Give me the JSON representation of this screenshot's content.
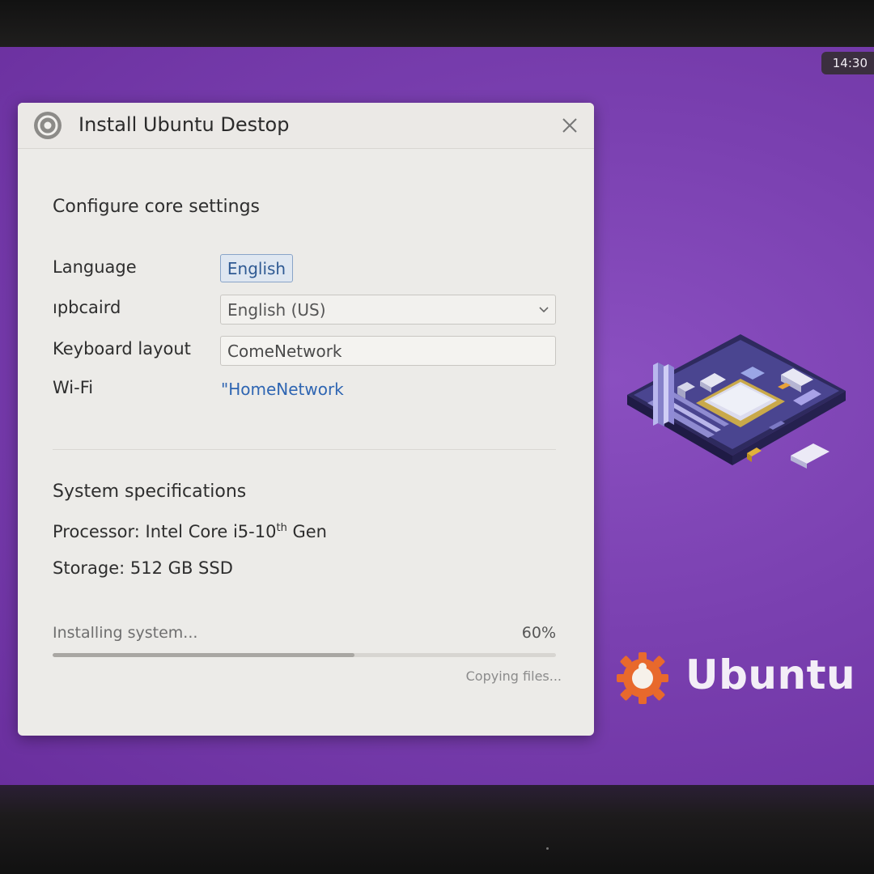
{
  "clock": "14:30",
  "window": {
    "title": "Install Ubuntu Destop"
  },
  "core_settings": {
    "heading": "Configure core settings",
    "language_label": "Language",
    "language_value": "English",
    "clipboard_label": "​ıpbcaird",
    "clipboard_value": "English (US)",
    "keyboard_label": "Keyboard layout",
    "keyboard_value": "ComeNetwork",
    "wifi_label": "Wi-Fi",
    "wifi_value": "\"HomeNetwork"
  },
  "system_specs": {
    "heading": "System specifications",
    "processor_prefix": "Processor: Intel Core i5-10",
    "processor_sup": "th",
    "processor_suffix": " Gen",
    "storage": "Storage: 512 GB SSD"
  },
  "progress": {
    "label": "Installing system...",
    "percent_text": "60%",
    "fraction": 0.6,
    "status": "Copying files..."
  },
  "brand": {
    "name": "Ubuntu"
  },
  "icons": {
    "window_logo": "ubuntu-circle-icon",
    "close": "close-icon",
    "dropdown": "chevron-down-icon",
    "brand_logo": "ubuntu-gear-logo",
    "illustration": "motherboard-illustration"
  },
  "colors": {
    "desktop": "#7a40b0",
    "window": "#ecebe8",
    "accent_link": "#2e65b2",
    "brand_orange": "#e8692c"
  }
}
